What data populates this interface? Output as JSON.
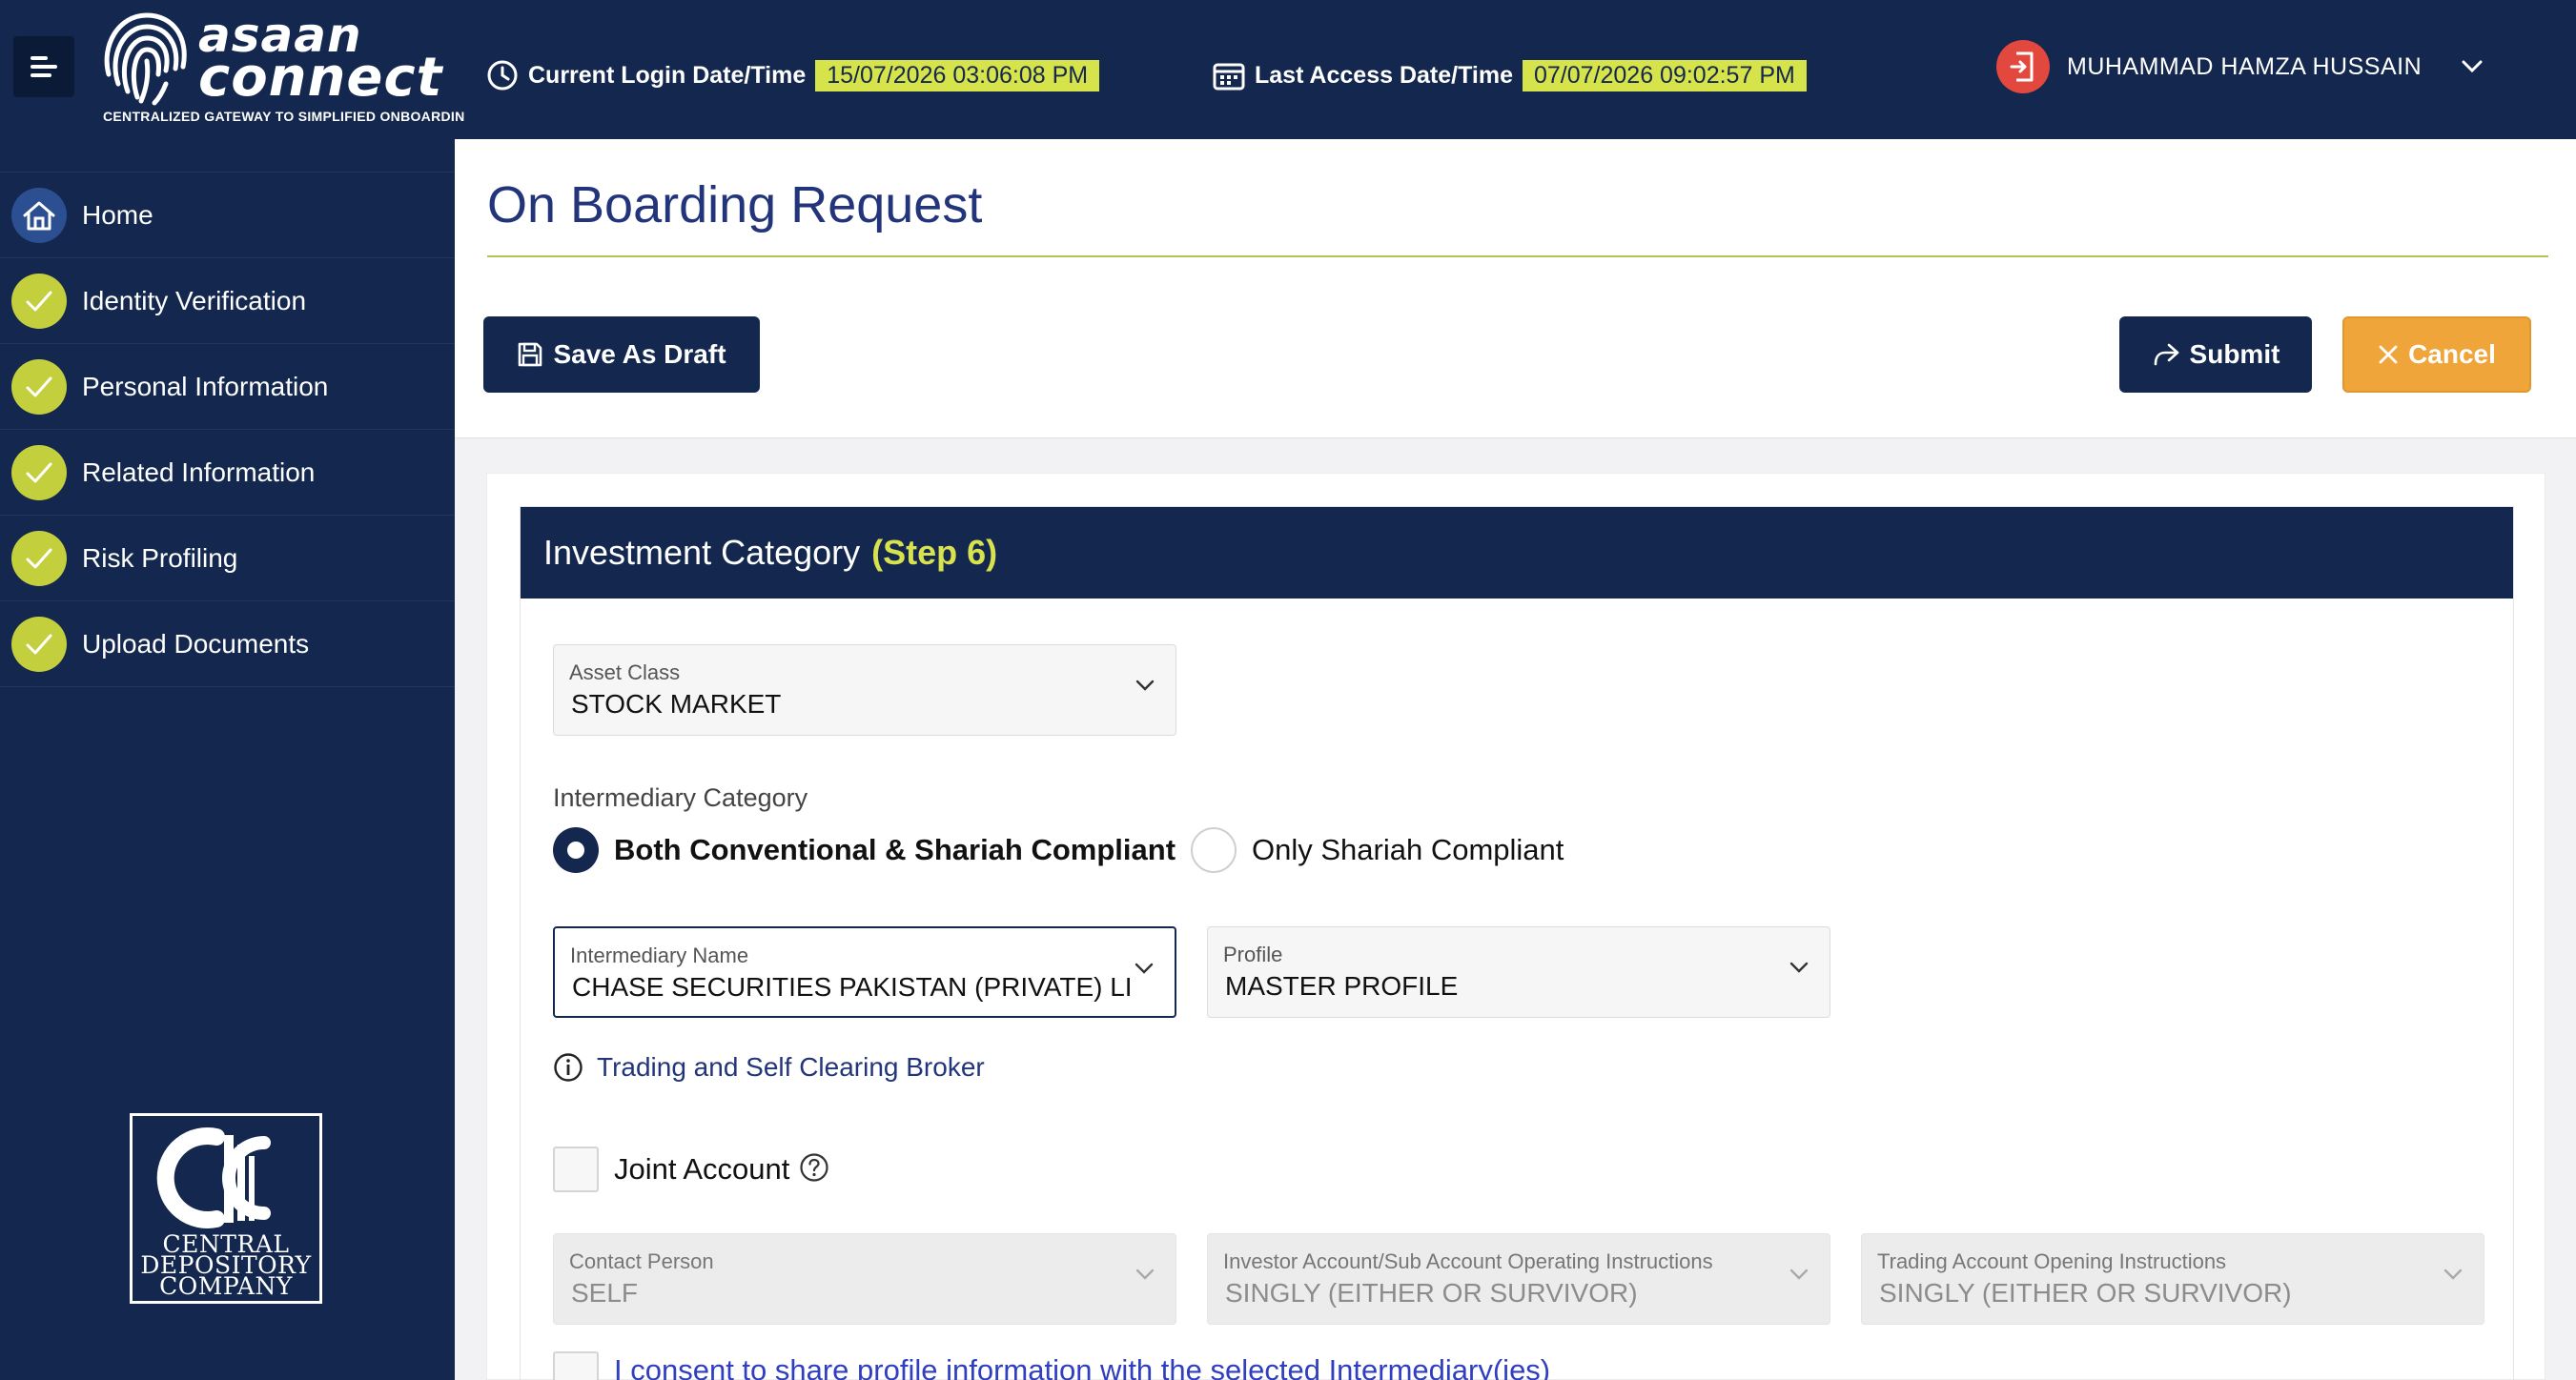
{
  "app": {
    "logo_line1": "asaan",
    "logo_line2": "connect",
    "tagline": "CENTRALIZED GATEWAY TO SIMPLIFIED ONBOARDIN"
  },
  "header": {
    "login_label": "Current Login Date/Time",
    "login_value": "15/07/2026 03:06:08 PM",
    "access_label": "Last Access Date/Time",
    "access_value": "07/07/2026 09:02:57 PM",
    "user_name": "MUHAMMAD HAMZA HUSSAIN"
  },
  "sidebar": {
    "items": [
      {
        "label": "Home",
        "icon": "home-icon"
      },
      {
        "label": "Identity Verification",
        "icon": "check-icon"
      },
      {
        "label": "Personal Information",
        "icon": "check-icon"
      },
      {
        "label": "Related Information",
        "icon": "check-icon"
      },
      {
        "label": "Risk Profiling",
        "icon": "check-icon"
      },
      {
        "label": "Upload Documents",
        "icon": "check-icon"
      }
    ],
    "company_line1": "CENTRAL",
    "company_line2": "DEPOSITORY",
    "company_line3": "COMPANY"
  },
  "page": {
    "title": "On Boarding Request",
    "save_draft_label": "Save As Draft",
    "submit_label": "Submit",
    "cancel_label": "Cancel"
  },
  "form": {
    "section_title": "Investment Category",
    "section_step": "(Step 6)",
    "asset_class": {
      "label": "Asset Class",
      "value": "STOCK MARKET"
    },
    "intermediary_category_label": "Intermediary Category",
    "radio_options": [
      {
        "label": "Both Conventional & Shariah Compliant",
        "selected": true
      },
      {
        "label": "Only Shariah Compliant",
        "selected": false
      }
    ],
    "intermediary_name": {
      "label": "Intermediary Name",
      "value": "CHASE SECURITIES PAKISTAN (PRIVATE) LIMITED"
    },
    "profile": {
      "label": "Profile",
      "value": "MASTER PROFILE"
    },
    "intermediary_hint": "Trading and Self Clearing Broker",
    "joint_account_label": "Joint Account",
    "contact_person": {
      "label": "Contact Person",
      "value": "SELF"
    },
    "investor_instructions": {
      "label": "Investor Account/Sub Account Operating Instructions",
      "value": "SINGLY (EITHER OR SURVIVOR)"
    },
    "trading_instructions": {
      "label": "Trading Account Opening Instructions",
      "value": "SINGLY (EITHER OR SURVIVOR)"
    },
    "consent_label": "I consent to share profile information with the selected Intermediary(ies)"
  },
  "colors": {
    "navy": "#14284f",
    "accent_yellow": "#d7e34a",
    "check_green": "#c4cf3e",
    "cancel_orange": "#f0a53a",
    "title_blue": "#23357a"
  }
}
